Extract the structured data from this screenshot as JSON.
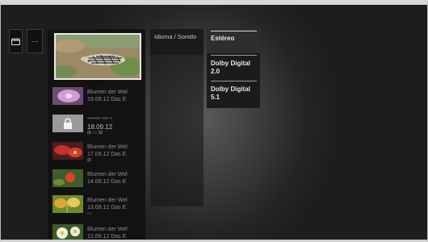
{
  "toolbar": {
    "more_label": "···"
  },
  "recordings": [
    {
      "line1": "Blumen der Wel",
      "line2": "19.09.12 Das E",
      "icons": ""
    },
    {
      "line1": "****** *** *",
      "line2": "18.09.12",
      "icons": "⊞ ▭ ⊠"
    },
    {
      "line1": "Blumen der Wel",
      "line2": "17.09.12 Das E",
      "icons": "⊞"
    },
    {
      "line1": "Blumen der Wel",
      "line2": "14.09.12 Das E",
      "icons": ""
    },
    {
      "line1": "Blumen der Wel",
      "line2": "13.09.12 Das E",
      "icons": "▭"
    },
    {
      "line1": "Blumen der Wel",
      "line2": "12.09.12 Das E",
      "icons": ""
    }
  ],
  "menu": {
    "category_label": "Idioma / Sonido",
    "options": [
      "Estéreo",
      "Dolby Digital 2.0",
      "Dolby Digital 5.1"
    ]
  }
}
